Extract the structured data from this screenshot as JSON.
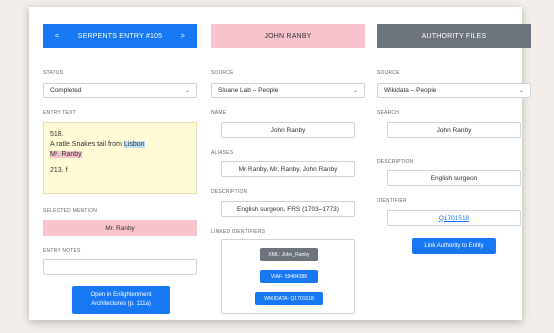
{
  "col1": {
    "header": {
      "prev": "<",
      "title": "SERPENTS ENTRY #105",
      "next": ">"
    },
    "status_label": "STATUS",
    "status_value": "Completed",
    "entry_text_label": "ENTRY TEXT",
    "entry_line1": "518.",
    "entry_line2_pre": "A ratle Snakes tail from ",
    "entry_line2_hl": "Lisbon",
    "entry_line3_hl": "Mʳ. Ranby",
    "entry_line4": "213. f",
    "selected_mention_label": "SELECTED MENTION",
    "selected_mention_value": "Mr. Ranby",
    "entry_notes_label": "ENTRY NOTES",
    "entry_notes_value": "",
    "open_button_line1": "Open in Enlightenment",
    "open_button_line2": "Architectures (p. 111a)"
  },
  "col2": {
    "header": "JOHN RANBY",
    "source_label": "SOURCE",
    "source_value": "Sloane Lab – People",
    "name_label": "NAME",
    "name_value": "John Ranby",
    "aliases_label": "ALIASES",
    "aliases_value": "Mr Ranby, Mr. Ranby, John Ranby",
    "description_label": "DESCRIPTION",
    "description_value": "English surgeon, FRS (1703–1773)",
    "linked_label": "LINKED IDENTIFIERS",
    "linked_ids": [
      "XML: John_Ranby",
      "VIAF: 59484388",
      "WIKIDATA: Q1701518"
    ]
  },
  "col3": {
    "header": "AUTHORITY FILES",
    "source_label": "SOURCE",
    "source_value": "Wikidata – People",
    "search_label": "SEARCH",
    "search_value": "John Ranby",
    "description_label": "DESCRIPTION",
    "description_value": "English surgeon",
    "identifier_label": "IDENTIFIER",
    "identifier_value": "Q1701518",
    "link_button": "Link Authority to Entity"
  },
  "colors": {
    "primary": "#1877f2",
    "pink": "#f8c3cc",
    "gray_header": "#6c737a",
    "entry_bg": "#fffbd6",
    "xml_pill": "#6c737a"
  }
}
